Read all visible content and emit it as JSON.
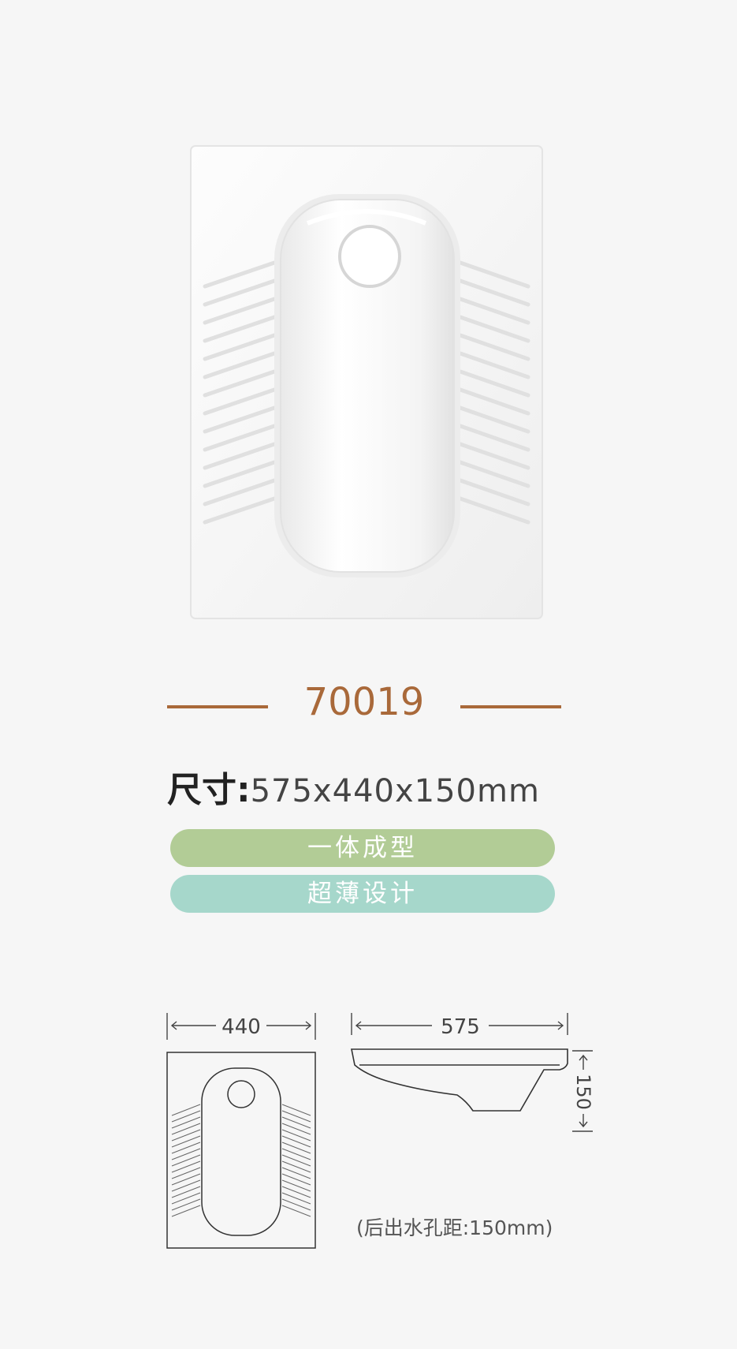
{
  "product": {
    "model": "70019",
    "size_label": "尺寸:",
    "size_value": "575x440x150mm",
    "features": [
      "一体成型",
      "超薄设计"
    ],
    "colors": {
      "accent": "#a9693a",
      "pill_green": "#b2cc96",
      "pill_teal": "#a6d7cb"
    }
  },
  "drawing": {
    "top_view_width": "440",
    "side_view_length": "575",
    "side_view_height": "150",
    "note": "(后出水孔距:150mm)"
  }
}
